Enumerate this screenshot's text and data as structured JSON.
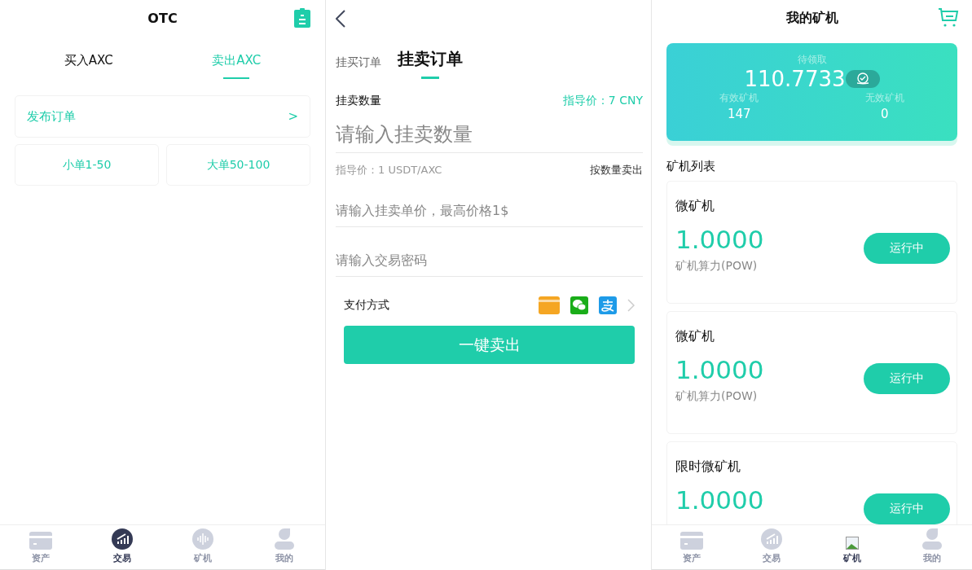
{
  "otc_screen": {
    "title": "OTC",
    "tabs": [
      {
        "label": "买入AXC",
        "selected": false
      },
      {
        "label": "卖出AXC",
        "selected": true
      }
    ],
    "publish": {
      "label": "发布订单",
      "arrow": ">"
    },
    "size_buttons": [
      "小单1-50",
      "大单50-100"
    ],
    "bottom_nav": [
      {
        "label": "资产",
        "kind": "card",
        "selected": false
      },
      {
        "label": "交易",
        "kind": "chart",
        "selected": true
      },
      {
        "label": "矿机",
        "kind": "wave",
        "selected": false
      },
      {
        "label": "我的",
        "kind": "person",
        "selected": false
      }
    ]
  },
  "sell_screen": {
    "tabs": [
      {
        "label": "挂买订单",
        "selected": false
      },
      {
        "label": "挂卖订单",
        "selected": true
      }
    ],
    "quantity_label": "挂卖数量",
    "guide_price": "指导价：7 CNY",
    "quantity_placeholder": "请输入挂卖数量",
    "unit_price_note": "指导价：1 USDT/AXC",
    "sell_by_quantity": "按数量卖出",
    "price_placeholder": "请输入挂卖单价，最高价格1$",
    "password_placeholder": "请输入交易密码",
    "payment_label": "支付方式",
    "payment_methods": [
      {
        "kind": "card"
      },
      {
        "kind": "wechat"
      },
      {
        "kind": "alipay"
      }
    ],
    "submit": "一键卖出"
  },
  "miner_screen": {
    "title": "我的矿机",
    "summary": {
      "label": "待领取",
      "amount": "110.7733",
      "stats": [
        {
          "label": "有效矿机",
          "value": "147"
        },
        {
          "label": "无效矿机",
          "value": "0"
        }
      ]
    },
    "list_title": "矿机列表",
    "miners": [
      {
        "name": "微矿机",
        "rate": "1.0000",
        "subtitle": "矿机算力(POW)",
        "status": "运行中"
      },
      {
        "name": "微矿机",
        "rate": "1.0000",
        "subtitle": "矿机算力(POW)",
        "status": "运行中"
      },
      {
        "name": "限时微矿机",
        "rate": "1.0000",
        "status": "运行中"
      }
    ],
    "bottom_nav": [
      {
        "label": "资产",
        "kind": "card",
        "selected": false
      },
      {
        "label": "交易",
        "kind": "chart",
        "selected": false
      },
      {
        "label": "矿机",
        "kind": "image",
        "selected": true
      },
      {
        "label": "我的",
        "kind": "person",
        "selected": false
      }
    ]
  }
}
